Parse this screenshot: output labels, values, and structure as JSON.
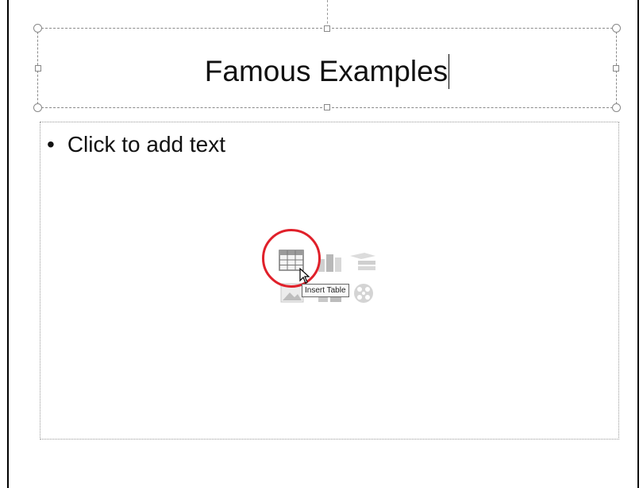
{
  "slide": {
    "title": "Famous Examples",
    "content": {
      "bullet": "•",
      "placeholder_text": "Click to add text"
    },
    "insert_icons": [
      {
        "name": "insert-table-icon"
      },
      {
        "name": "insert-chart-icon"
      },
      {
        "name": "insert-smartart-icon"
      },
      {
        "name": "insert-picture-icon"
      },
      {
        "name": "insert-clip-art-icon"
      },
      {
        "name": "insert-media-icon"
      }
    ],
    "tooltip": "Insert Table",
    "highlight_color": "#e0202a"
  }
}
